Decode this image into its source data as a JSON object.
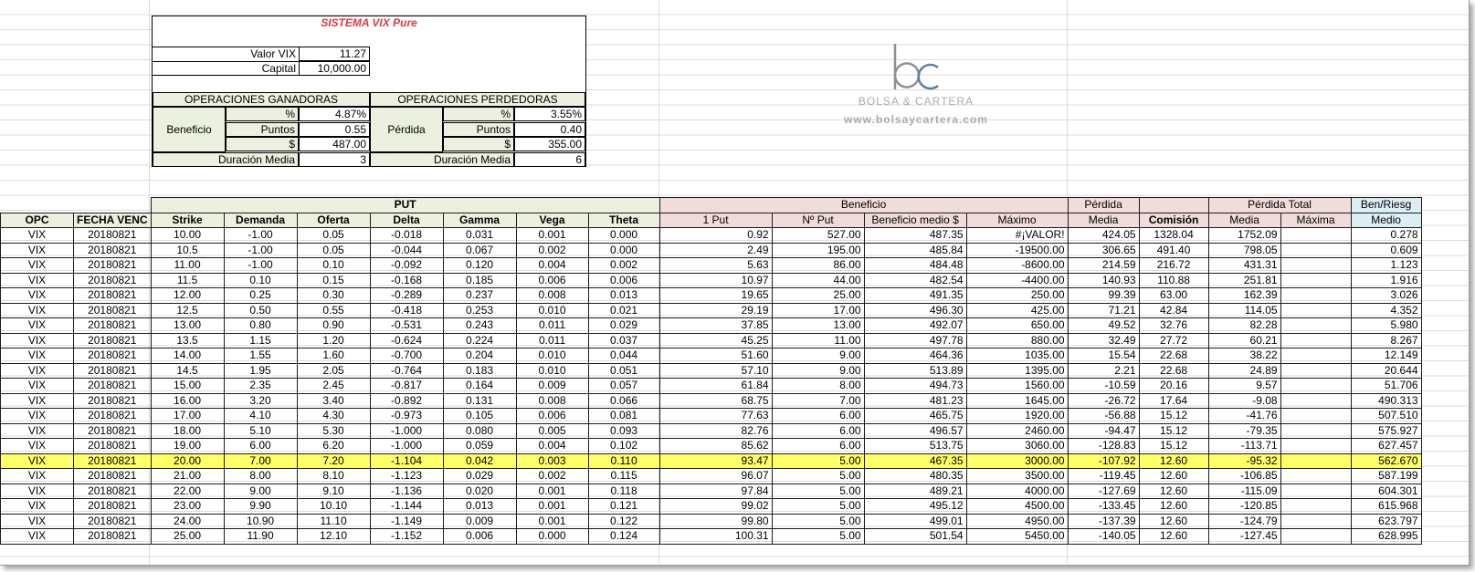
{
  "title": "SISTEMA VIX Pure",
  "valor_vix": {
    "label": "Valor VIX",
    "value": "11.27"
  },
  "capital": {
    "label": "Capital",
    "value": "10,000.00"
  },
  "ganadoras": {
    "header": "OPERACIONES GANADORAS",
    "row_label": "Beneficio",
    "pct_label": "%",
    "pct": "4.87%",
    "puntos_label": "Puntos",
    "puntos": "0.55",
    "usd_label": "$",
    "usd": "487.00",
    "dur_label": "Duración Media",
    "dur": "3"
  },
  "perdedoras": {
    "header": "OPERACIONES PERDEDORAS",
    "row_label": "Pérdida",
    "pct_label": "%",
    "pct": "3.55%",
    "puntos_label": "Puntos",
    "puntos": "0.40",
    "usd_label": "$",
    "usd": "355.00",
    "dur_label": "Duración Media",
    "dur": "6"
  },
  "logo": {
    "letters": "bc",
    "name": "BOLSA & CARTERA",
    "url": "www.bolsaycartera.com",
    "colors": {
      "b": "#8a8f98",
      "c": "#5b7fa8"
    }
  },
  "groups": {
    "put": "PUT",
    "beneficio": "Beneficio",
    "perdida": "Pérdida",
    "perdida_total": "Pérdida Total",
    "benriesg": "Ben/Riesg"
  },
  "columns": [
    "OPC",
    "FECHA VENC",
    "Strike",
    "Demanda",
    "Oferta",
    "Delta",
    "Gamma",
    "Vega",
    "Theta",
    "1 Put",
    "Nº Put",
    "Beneficio medio $",
    "Máximo",
    "Media",
    "Comisión",
    "Media",
    "Máxima",
    "Medio"
  ],
  "highlight_row": 15,
  "highlight_color": "#ffff66",
  "rows": [
    [
      "VIX",
      "20180821",
      "10.00",
      "-1.00",
      "0.05",
      "-0.018",
      "0.031",
      "0.001",
      "0.000",
      "0.92",
      "527.00",
      "487.35",
      "#¡VALOR!",
      "424.05",
      "1328.04",
      "1752.09",
      "",
      "0.278"
    ],
    [
      "VIX",
      "20180821",
      "10.5",
      "-1.00",
      "0.05",
      "-0.044",
      "0.067",
      "0.002",
      "0.000",
      "2.49",
      "195.00",
      "485.84",
      "-19500.00",
      "306.65",
      "491.40",
      "798.05",
      "",
      "0.609"
    ],
    [
      "VIX",
      "20180821",
      "11.00",
      "-1.00",
      "0.10",
      "-0.092",
      "0.120",
      "0.004",
      "0.002",
      "5.63",
      "86.00",
      "484.48",
      "-8600.00",
      "214.59",
      "216.72",
      "431.31",
      "",
      "1.123"
    ],
    [
      "VIX",
      "20180821",
      "11.5",
      "0.10",
      "0.15",
      "-0.168",
      "0.185",
      "0.006",
      "0.006",
      "10.97",
      "44.00",
      "482.54",
      "-4400.00",
      "140.93",
      "110.88",
      "251.81",
      "",
      "1.916"
    ],
    [
      "VIX",
      "20180821",
      "12.00",
      "0.25",
      "0.30",
      "-0.289",
      "0.237",
      "0.008",
      "0.013",
      "19.65",
      "25.00",
      "491.35",
      "250.00",
      "99.39",
      "63.00",
      "162.39",
      "",
      "3.026"
    ],
    [
      "VIX",
      "20180821",
      "12.5",
      "0.50",
      "0.55",
      "-0.418",
      "0.253",
      "0.010",
      "0.021",
      "29.19",
      "17.00",
      "496.30",
      "425.00",
      "71.21",
      "42.84",
      "114.05",
      "",
      "4.352"
    ],
    [
      "VIX",
      "20180821",
      "13.00",
      "0.80",
      "0.90",
      "-0.531",
      "0.243",
      "0.011",
      "0.029",
      "37.85",
      "13.00",
      "492.07",
      "650.00",
      "49.52",
      "32.76",
      "82.28",
      "",
      "5.980"
    ],
    [
      "VIX",
      "20180821",
      "13.5",
      "1.15",
      "1.20",
      "-0.624",
      "0.224",
      "0.011",
      "0.037",
      "45.25",
      "11.00",
      "497.78",
      "880.00",
      "32.49",
      "27.72",
      "60.21",
      "",
      "8.267"
    ],
    [
      "VIX",
      "20180821",
      "14.00",
      "1.55",
      "1.60",
      "-0.700",
      "0.204",
      "0.010",
      "0.044",
      "51.60",
      "9.00",
      "464.36",
      "1035.00",
      "15.54",
      "22.68",
      "38.22",
      "",
      "12.149"
    ],
    [
      "VIX",
      "20180821",
      "14.5",
      "1.95",
      "2.05",
      "-0.764",
      "0.183",
      "0.010",
      "0.051",
      "57.10",
      "9.00",
      "513.89",
      "1395.00",
      "2.21",
      "22.68",
      "24.89",
      "",
      "20.644"
    ],
    [
      "VIX",
      "20180821",
      "15.00",
      "2.35",
      "2.45",
      "-0.817",
      "0.164",
      "0.009",
      "0.057",
      "61.84",
      "8.00",
      "494.73",
      "1560.00",
      "-10.59",
      "20.16",
      "9.57",
      "",
      "51.706"
    ],
    [
      "VIX",
      "20180821",
      "16.00",
      "3.20",
      "3.40",
      "-0.892",
      "0.131",
      "0.008",
      "0.066",
      "68.75",
      "7.00",
      "481.23",
      "1645.00",
      "-26.72",
      "17.64",
      "-9.08",
      "",
      "490.313"
    ],
    [
      "VIX",
      "20180821",
      "17.00",
      "4.10",
      "4.30",
      "-0.973",
      "0.105",
      "0.006",
      "0.081",
      "77.63",
      "6.00",
      "465.75",
      "1920.00",
      "-56.88",
      "15.12",
      "-41.76",
      "",
      "507.510"
    ],
    [
      "VIX",
      "20180821",
      "18.00",
      "5.10",
      "5.30",
      "-1.000",
      "0.080",
      "0.005",
      "0.093",
      "82.76",
      "6.00",
      "496.57",
      "2460.00",
      "-94.47",
      "15.12",
      "-79.35",
      "",
      "575.927"
    ],
    [
      "VIX",
      "20180821",
      "19.00",
      "6.00",
      "6.20",
      "-1.000",
      "0.059",
      "0.004",
      "0.102",
      "85.62",
      "6.00",
      "513.75",
      "3060.00",
      "-128.83",
      "15.12",
      "-113.71",
      "",
      "627.457"
    ],
    [
      "VIX",
      "20180821",
      "20.00",
      "7.00",
      "7.20",
      "-1.104",
      "0.042",
      "0.003",
      "0.110",
      "93.47",
      "5.00",
      "467.35",
      "3000.00",
      "-107.92",
      "12.60",
      "-95.32",
      "",
      "562.670"
    ],
    [
      "VIX",
      "20180821",
      "21.00",
      "8.00",
      "8.10",
      "-1.123",
      "0.029",
      "0.002",
      "0.115",
      "96.07",
      "5.00",
      "480.35",
      "3500.00",
      "-119.45",
      "12.60",
      "-106.85",
      "",
      "587.199"
    ],
    [
      "VIX",
      "20180821",
      "22.00",
      "9.00",
      "9.10",
      "-1.136",
      "0.020",
      "0.001",
      "0.118",
      "97.84",
      "5.00",
      "489.21",
      "4000.00",
      "-127.69",
      "12.60",
      "-115.09",
      "",
      "604.301"
    ],
    [
      "VIX",
      "20180821",
      "23.00",
      "9.90",
      "10.10",
      "-1.144",
      "0.013",
      "0.001",
      "0.121",
      "99.02",
      "5.00",
      "495.12",
      "4500.00",
      "-133.45",
      "12.60",
      "-120.85",
      "",
      "615.968"
    ],
    [
      "VIX",
      "20180821",
      "24.00",
      "10.90",
      "11.10",
      "-1.149",
      "0.009",
      "0.001",
      "0.122",
      "99.80",
      "5.00",
      "499.01",
      "4950.00",
      "-137.39",
      "12.60",
      "-124.79",
      "",
      "623.797"
    ],
    [
      "VIX",
      "20180821",
      "25.00",
      "11.90",
      "12.10",
      "-1.152",
      "0.006",
      "0.000",
      "0.124",
      "100.31",
      "5.00",
      "501.54",
      "5450.00",
      "-140.05",
      "12.60",
      "-127.45",
      "",
      "628.995"
    ]
  ]
}
